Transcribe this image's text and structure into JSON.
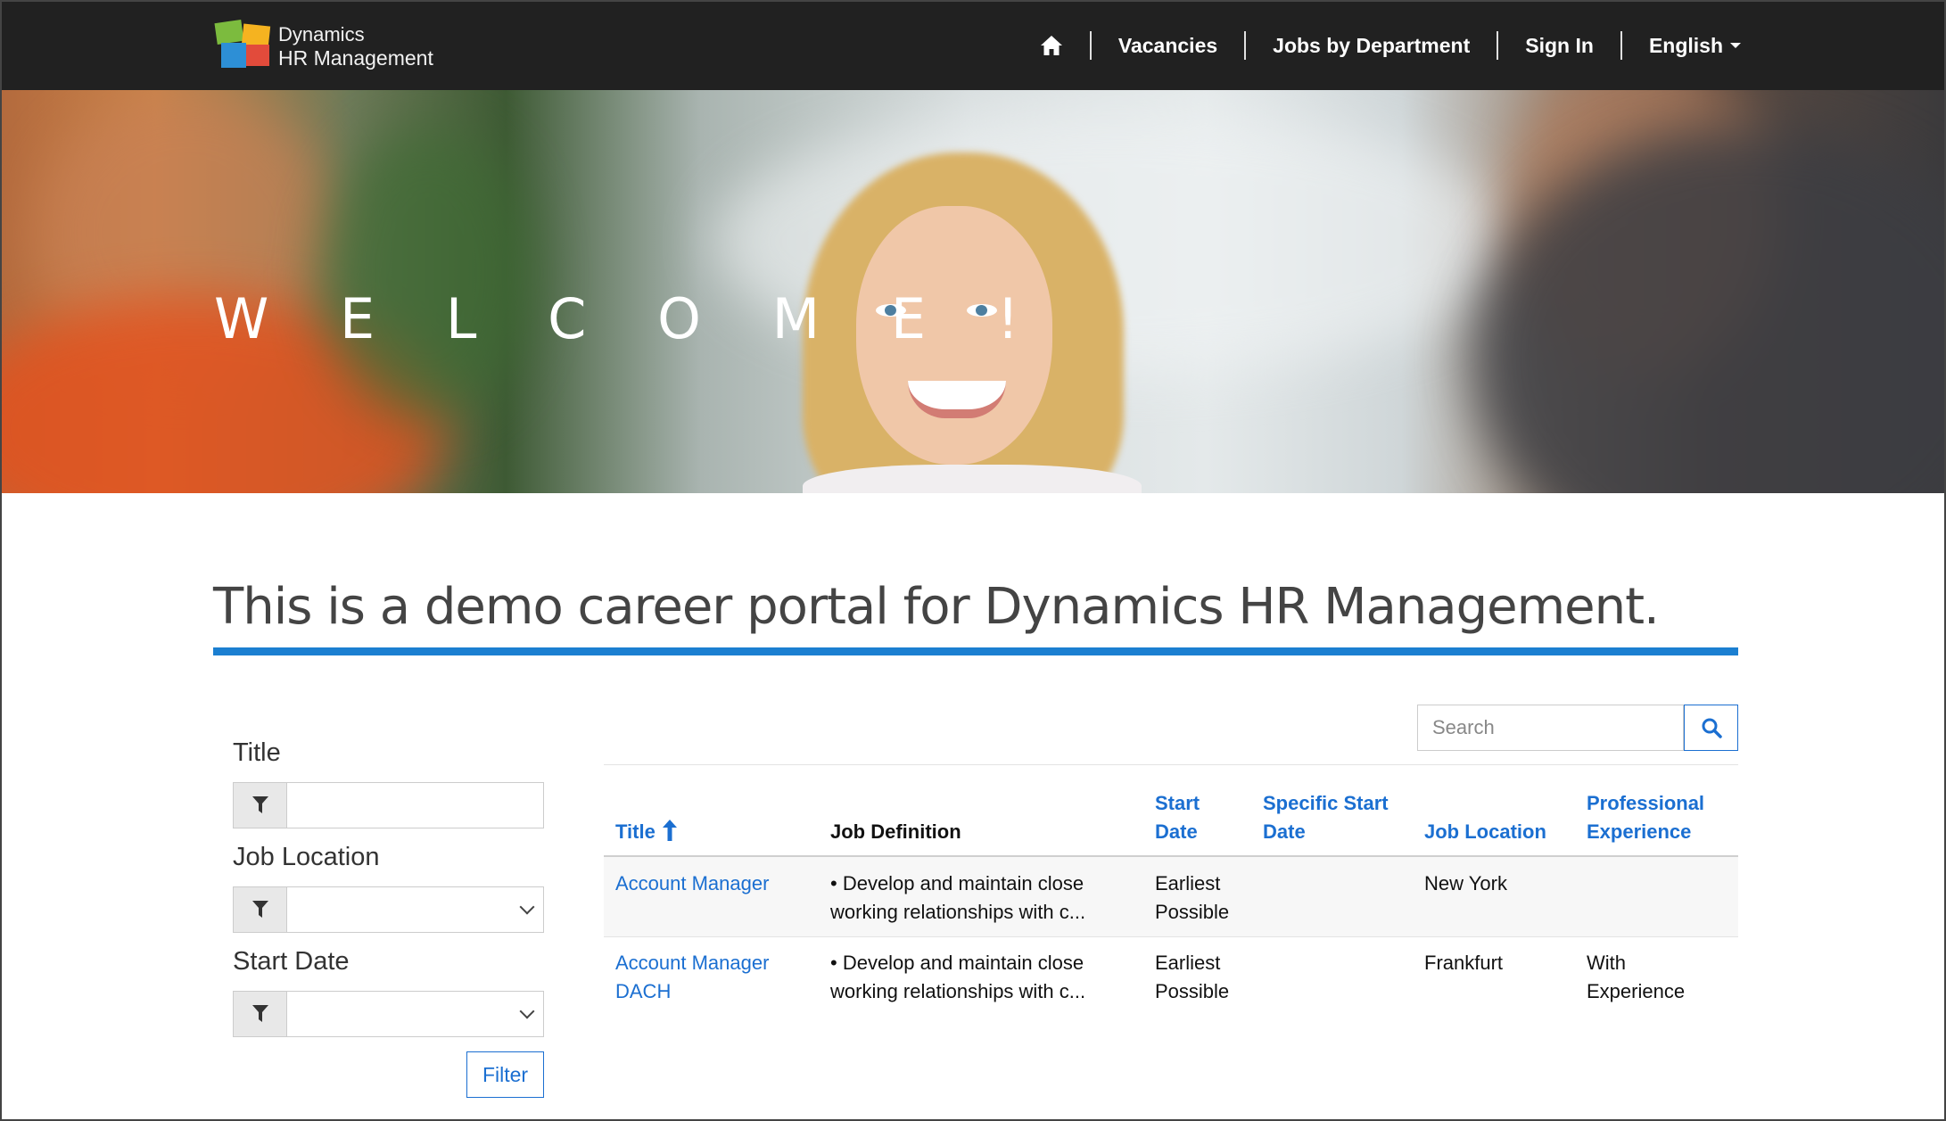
{
  "brand": {
    "line1": "Dynamics",
    "line2": "HR Management"
  },
  "nav": {
    "home_icon": "home-icon",
    "items": [
      "Vacancies",
      "Jobs by Department",
      "Sign In"
    ],
    "language": "English"
  },
  "hero": {
    "welcome": "W E L C O M E !"
  },
  "heading": "This is a demo career portal for Dynamics HR Management.",
  "filters": {
    "title_label": "Title",
    "location_label": "Job Location",
    "start_label": "Start Date",
    "button": "Filter"
  },
  "search": {
    "placeholder": "Search"
  },
  "table": {
    "columns": {
      "title": "Title",
      "job_definition": "Job Definition",
      "start_date_l1": "Start",
      "start_date_l2": "Date",
      "specific_l1": "Specific Start",
      "specific_l2": "Date",
      "job_location": "Job Location",
      "experience_l1": "Professional",
      "experience_l2": "Experience"
    },
    "rows": [
      {
        "title_l1": "Account Manager",
        "title_l2": "",
        "def_l1": "• Develop and maintain close",
        "def_l2": "working relationships with c...",
        "start_l1": "Earliest",
        "start_l2": "Possible",
        "specific": "",
        "location": "New York",
        "exp_l1": "",
        "exp_l2": ""
      },
      {
        "title_l1": "Account Manager",
        "title_l2": "DACH",
        "def_l1": "• Develop and maintain close",
        "def_l2": "working relationships with c...",
        "start_l1": "Earliest",
        "start_l2": "Possible",
        "specific": "",
        "location": "Frankfurt",
        "exp_l1": "With",
        "exp_l2": "Experience"
      }
    ]
  },
  "colors": {
    "navbar": "#212121",
    "accent": "#1b7fd1",
    "link": "#1b6fd1"
  }
}
